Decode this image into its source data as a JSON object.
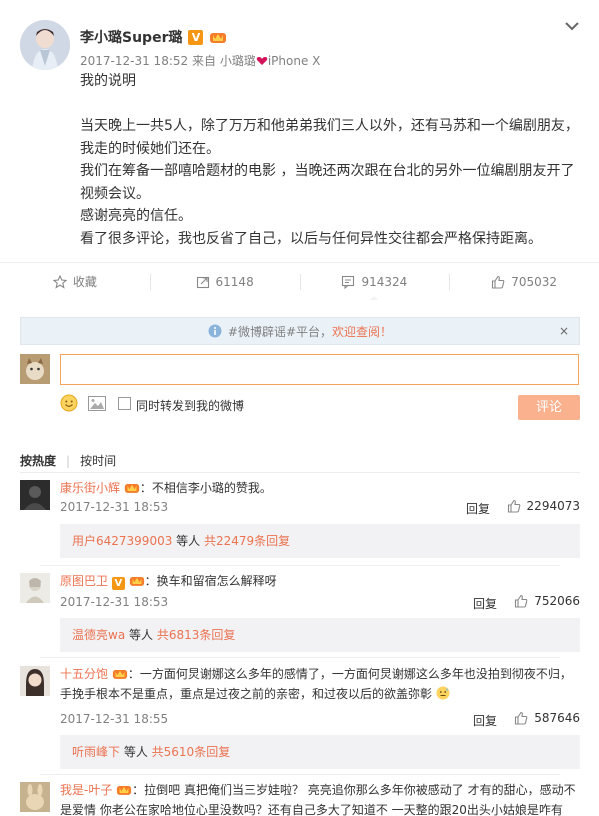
{
  "post": {
    "author": "李小璐Super璐",
    "verified_badge": "V",
    "timestamp": "2017-12-31 18:52",
    "source_prefix": "来自",
    "source_name": "小璐璐",
    "source_device": "iPhone X",
    "body": [
      "我的说明",
      "",
      "当天晚上一共5人，除了万万和他弟弟我们三人以外，还有马苏和一个编剧朋友，",
      "我走的时候她们还在。",
      "我们在筹备一部嘻哈题材的电影 ，当晚还两次跟在台北的另外一位编剧朋友开了",
      "视频会议。",
      "感谢亮亮的信任。",
      "看了很多评论，我也反省了自己，以后与任何异性交往都会严格保持距离。"
    ]
  },
  "actions": {
    "favorite": "收藏",
    "repost_count": "61148",
    "comment_count": "914324",
    "like_count": "705032"
  },
  "notice": {
    "prefix": "#微博辟谣#平台，",
    "highlight": "欢迎查阅！",
    "close": "×"
  },
  "composer": {
    "input_value": "",
    "forward_label": "同时转发到我的微博",
    "submit_label": "评论"
  },
  "sort": {
    "hot": "按热度",
    "time": "按时间"
  },
  "comments": [
    {
      "user": "康乐街小辉",
      "text": "：不相信李小璐的赞我。",
      "time": "2017-12-31 18:53",
      "reply": "回复",
      "likes": "2294073",
      "sub_user": "用户6427399003",
      "sub_mid": " 等人 ",
      "sub_link": "共22479条回复"
    },
    {
      "user": "原图巴卫",
      "text": "：换车和留宿怎么解释呀",
      "time": "2017-12-31 18:53",
      "reply": "回复",
      "likes": "752066",
      "sub_user": "温德亮wa",
      "sub_mid": " 等人 ",
      "sub_link": "共6813条回复"
    },
    {
      "user": "十五分饱",
      "text": "：一方面何炅谢娜这么多年的感情了，一方面何炅谢娜这么多年也没拍到彻夜不归，",
      "text2": "手挽手根本不是重点，重点是过夜之前的亲密，和过夜以后的欲盖弥彰",
      "time": "2017-12-31 18:55",
      "reply": "回复",
      "likes": "587646",
      "sub_user": "听雨峰下",
      "sub_mid": " 等人 ",
      "sub_link": "共5610条回复"
    },
    {
      "user": "我是-叶子",
      "text": "：拉倒吧 真把俺们当三岁娃啦？ 亮亮追你那么多年你被感动了 才有的甜心，感动不",
      "text2": "是爱情 你老公在家哈地位心里没数吗？还有自己多大了知道不 一天整的跟20出头小姑娘是咋有"
    }
  ],
  "colors": {
    "accent": "#eb7350",
    "input_border": "#f6a35f",
    "submit_bg": "#fab18e",
    "verified": "#f59614"
  }
}
